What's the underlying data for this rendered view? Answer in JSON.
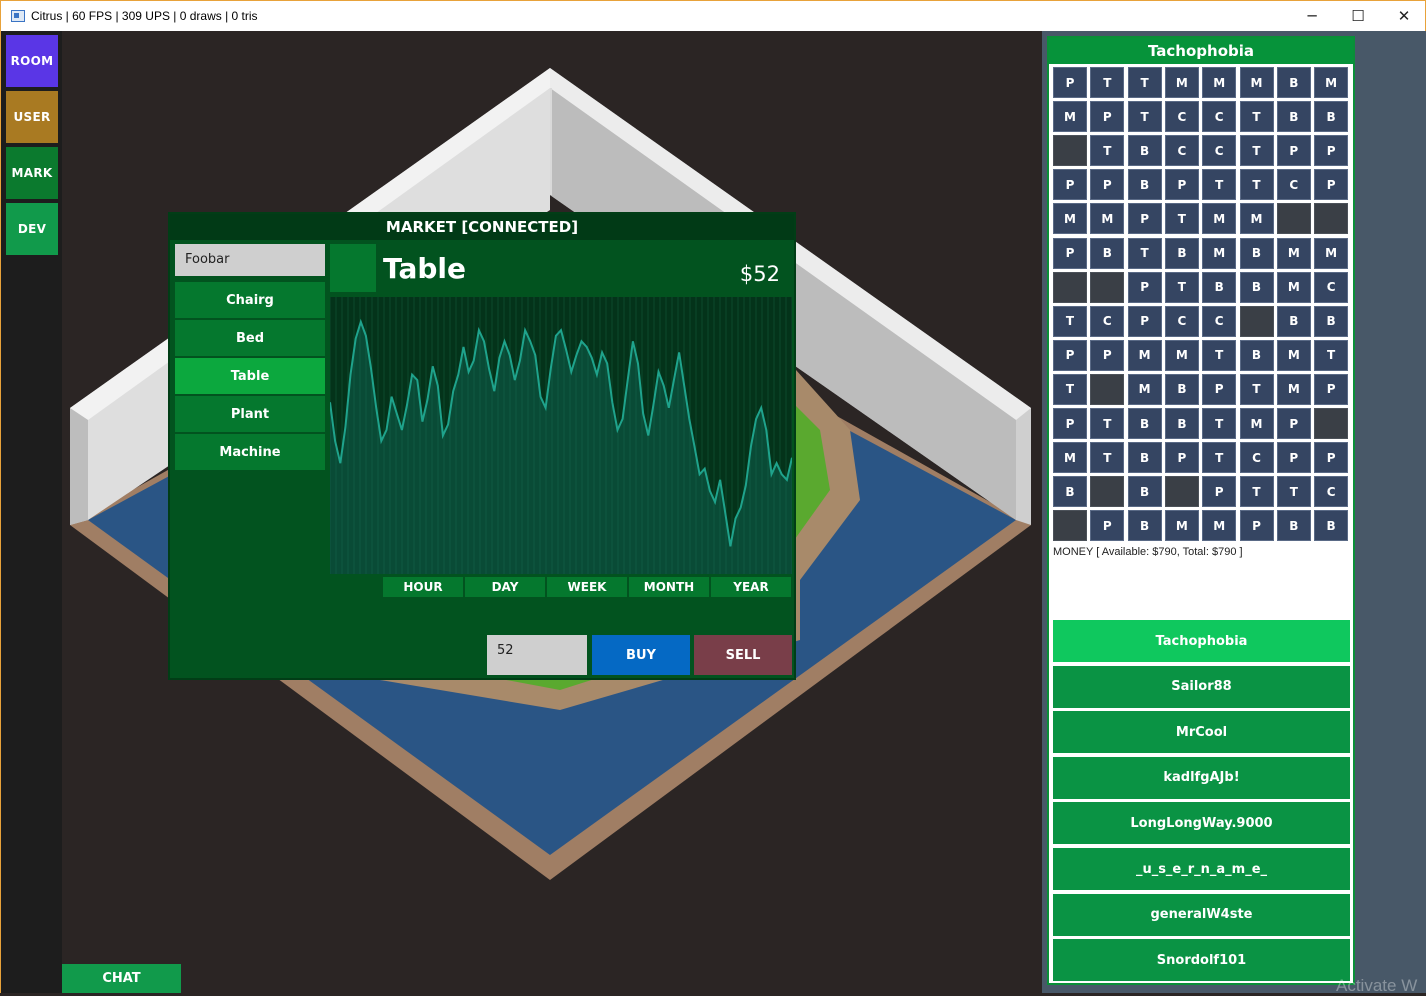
{
  "window": {
    "title": "Citrus | 60 FPS | 309 UPS | 0 draws | 0 tris",
    "controls": {
      "minimize": "─",
      "maximize": "☐",
      "close": "✕"
    }
  },
  "sidebar": {
    "buttons": [
      {
        "label": "ROOM",
        "color": "#5a36e6"
      },
      {
        "label": "USER",
        "color": "#a97a22"
      },
      {
        "label": "MARK",
        "color": "#0b7a2e"
      },
      {
        "label": "DEV",
        "color": "#119a4b"
      }
    ]
  },
  "chat": {
    "label": "CHAT"
  },
  "market": {
    "title": "MARKET [CONNECTED]",
    "search_value": "Foobar",
    "items": [
      "Chairg",
      "Bed",
      "Table",
      "Plant",
      "Machine"
    ],
    "selected_item": "Table",
    "item_name": "Table",
    "price": "$52",
    "ranges": [
      "HOUR",
      "DAY",
      "WEEK",
      "MONTH",
      "YEAR"
    ],
    "quantity": "52",
    "buy_label": "BUY",
    "sell_label": "SELL"
  },
  "chart_data": {
    "type": "area",
    "title": "",
    "xlabel": "",
    "ylabel": "",
    "values": [
      62,
      48,
      40,
      53,
      72,
      85,
      91,
      86,
      74,
      60,
      48,
      52,
      64,
      58,
      52,
      61,
      72,
      70,
      55,
      63,
      75,
      68,
      50,
      54,
      66,
      72,
      82,
      73,
      77,
      88,
      84,
      74,
      66,
      78,
      84,
      79,
      70,
      77,
      88,
      84,
      79,
      64,
      60,
      74,
      86,
      88,
      81,
      73,
      79,
      84,
      82,
      78,
      72,
      80,
      76,
      62,
      52,
      56,
      70,
      84,
      76,
      58,
      50,
      61,
      73,
      68,
      60,
      70,
      80,
      68,
      56,
      46,
      36,
      38,
      30,
      26,
      34,
      22,
      10,
      20,
      24,
      32,
      46,
      56,
      60,
      52,
      36,
      40,
      36,
      34,
      42
    ],
    "ylim": [
      0,
      100
    ],
    "grid": true
  },
  "player": {
    "name": "Tachophobia",
    "inventory_rows": [
      [
        "P",
        "T",
        "T",
        "M",
        "M",
        "M",
        "B",
        "M"
      ],
      [
        "M",
        "P",
        "T",
        "C",
        "C",
        "T",
        "B",
        "B"
      ],
      [
        "",
        "T",
        "B",
        "C",
        "C",
        "T",
        "P",
        "P"
      ],
      [
        "P",
        "P",
        "B",
        "P",
        "T",
        "T",
        "C",
        "P"
      ],
      [
        "M",
        "M",
        "P",
        "T",
        "M",
        "M",
        "",
        ""
      ],
      [
        "P",
        "B",
        "T",
        "B",
        "M",
        "B",
        "M",
        "M"
      ],
      [
        "",
        "",
        "P",
        "T",
        "B",
        "B",
        "M",
        "C"
      ],
      [
        "T",
        "C",
        "P",
        "C",
        "C",
        "",
        "B",
        "B"
      ],
      [
        "P",
        "P",
        "M",
        "M",
        "T",
        "B",
        "M",
        "T"
      ],
      [
        "T",
        "",
        "M",
        "B",
        "P",
        "T",
        "M",
        "P"
      ],
      [
        "P",
        "T",
        "B",
        "B",
        "T",
        "M",
        "P",
        ""
      ],
      [
        "M",
        "T",
        "B",
        "P",
        "T",
        "C",
        "P",
        "P"
      ],
      [
        "B",
        "",
        "B",
        "",
        "P",
        "T",
        "T",
        "C"
      ],
      [
        "",
        "P",
        "B",
        "M",
        "M",
        "P",
        "B",
        "B"
      ]
    ],
    "money_text": "MONEY [ Available: $790, Total: $790 ]"
  },
  "users": [
    "Tachophobia",
    "Sailor88",
    "MrCool",
    "kadlfgAJb!",
    "LongLongWay.9000",
    "_u_s_e_r_n_a_m_e_",
    "generalW4ste",
    "Snordolf101"
  ],
  "activate_text": "Activate W"
}
